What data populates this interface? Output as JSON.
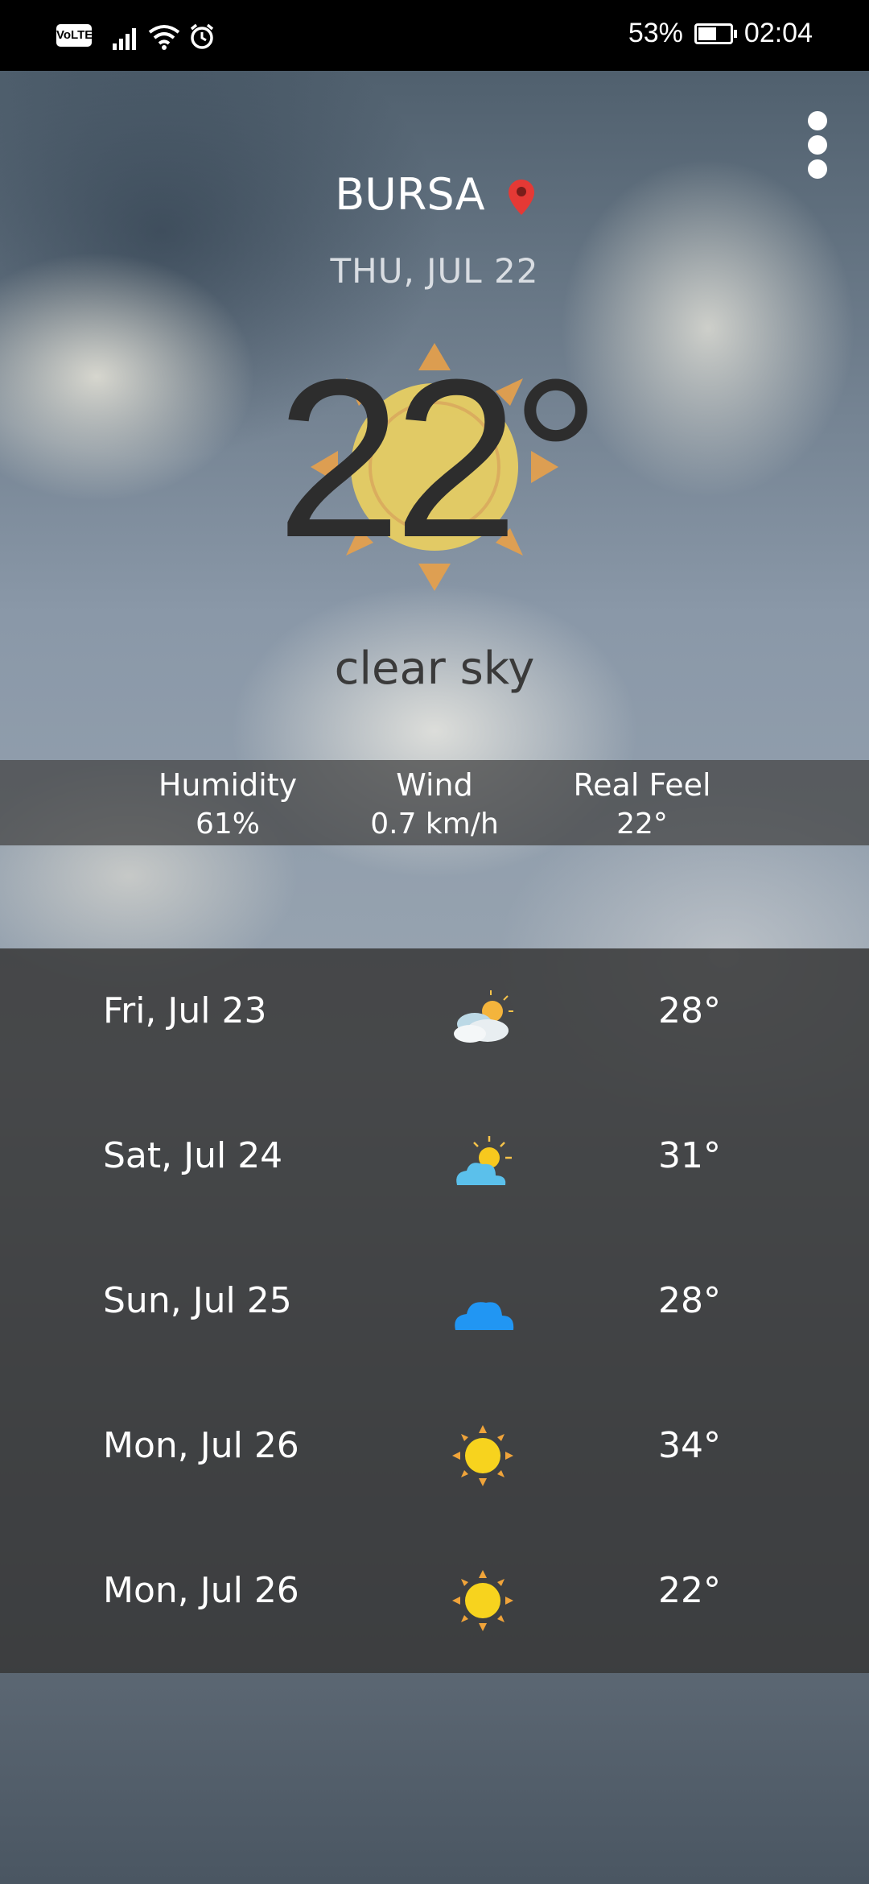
{
  "status_bar": {
    "volte": "VoLTE",
    "battery_percent": "53%",
    "battery_level": 0.53,
    "time": "02:04",
    "icons": [
      "signal-icon",
      "wifi-icon",
      "alarm-icon",
      "battery-icon"
    ]
  },
  "header": {
    "city": "BURSA",
    "date": "THU, JUL 22",
    "menu_icon": "more-vert-icon",
    "pin_icon": "location-pin-icon"
  },
  "current": {
    "temperature": "22°",
    "description": "clear sky",
    "icon": "sun-icon"
  },
  "stats": {
    "humidity_label": "Humidity",
    "humidity_value": "61%",
    "wind_label": "Wind",
    "wind_value": "0.7 km/h",
    "realfeel_label": "Real Feel",
    "realfeel_value": "22°"
  },
  "forecast": [
    {
      "day": "Fri, Jul 23",
      "icon": "partly-cloudy-icon",
      "temp": "28°"
    },
    {
      "day": "Sat, Jul 24",
      "icon": "sun-cloud-icon",
      "temp": "31°"
    },
    {
      "day": "Sun, Jul 25",
      "icon": "cloud-icon",
      "temp": "28°"
    },
    {
      "day": "Mon, Jul 26",
      "icon": "sun-icon",
      "temp": "34°"
    },
    {
      "day": "Mon, Jul 26",
      "icon": "sun-icon",
      "temp": "22°"
    }
  ],
  "colors": {
    "pin": "#e53935",
    "sun": "#f7c81e",
    "sun_rays": "#f0a43a",
    "cloud_blue": "#2196f3",
    "cloud_light": "#5bc0eb"
  }
}
